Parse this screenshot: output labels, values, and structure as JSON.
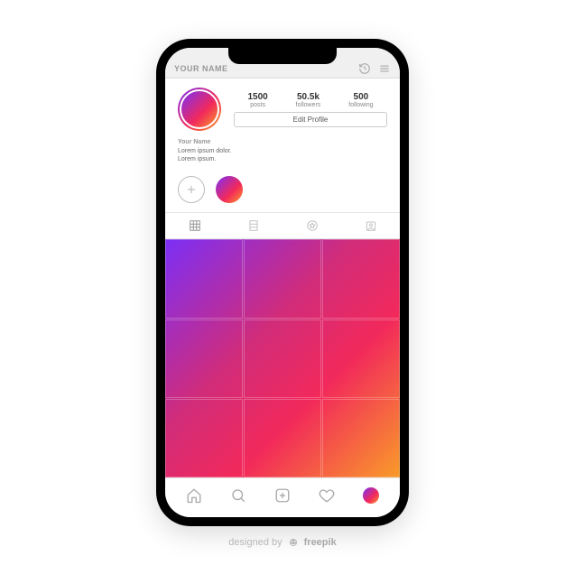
{
  "header": {
    "title": "YOUR NAME"
  },
  "profile": {
    "stats": {
      "posts": {
        "value": "1500",
        "label": "posts"
      },
      "followers": {
        "value": "50.5k",
        "label": "followers"
      },
      "following": {
        "value": "500",
        "label": "following"
      }
    },
    "edit_label": "Edit Profile",
    "display_name": "Your Name",
    "bio_line1": "Lorem ipsum dolor.",
    "bio_line2": "Lorem ipsum."
  },
  "credit": {
    "prefix": "designed by",
    "brand": "freepik"
  }
}
